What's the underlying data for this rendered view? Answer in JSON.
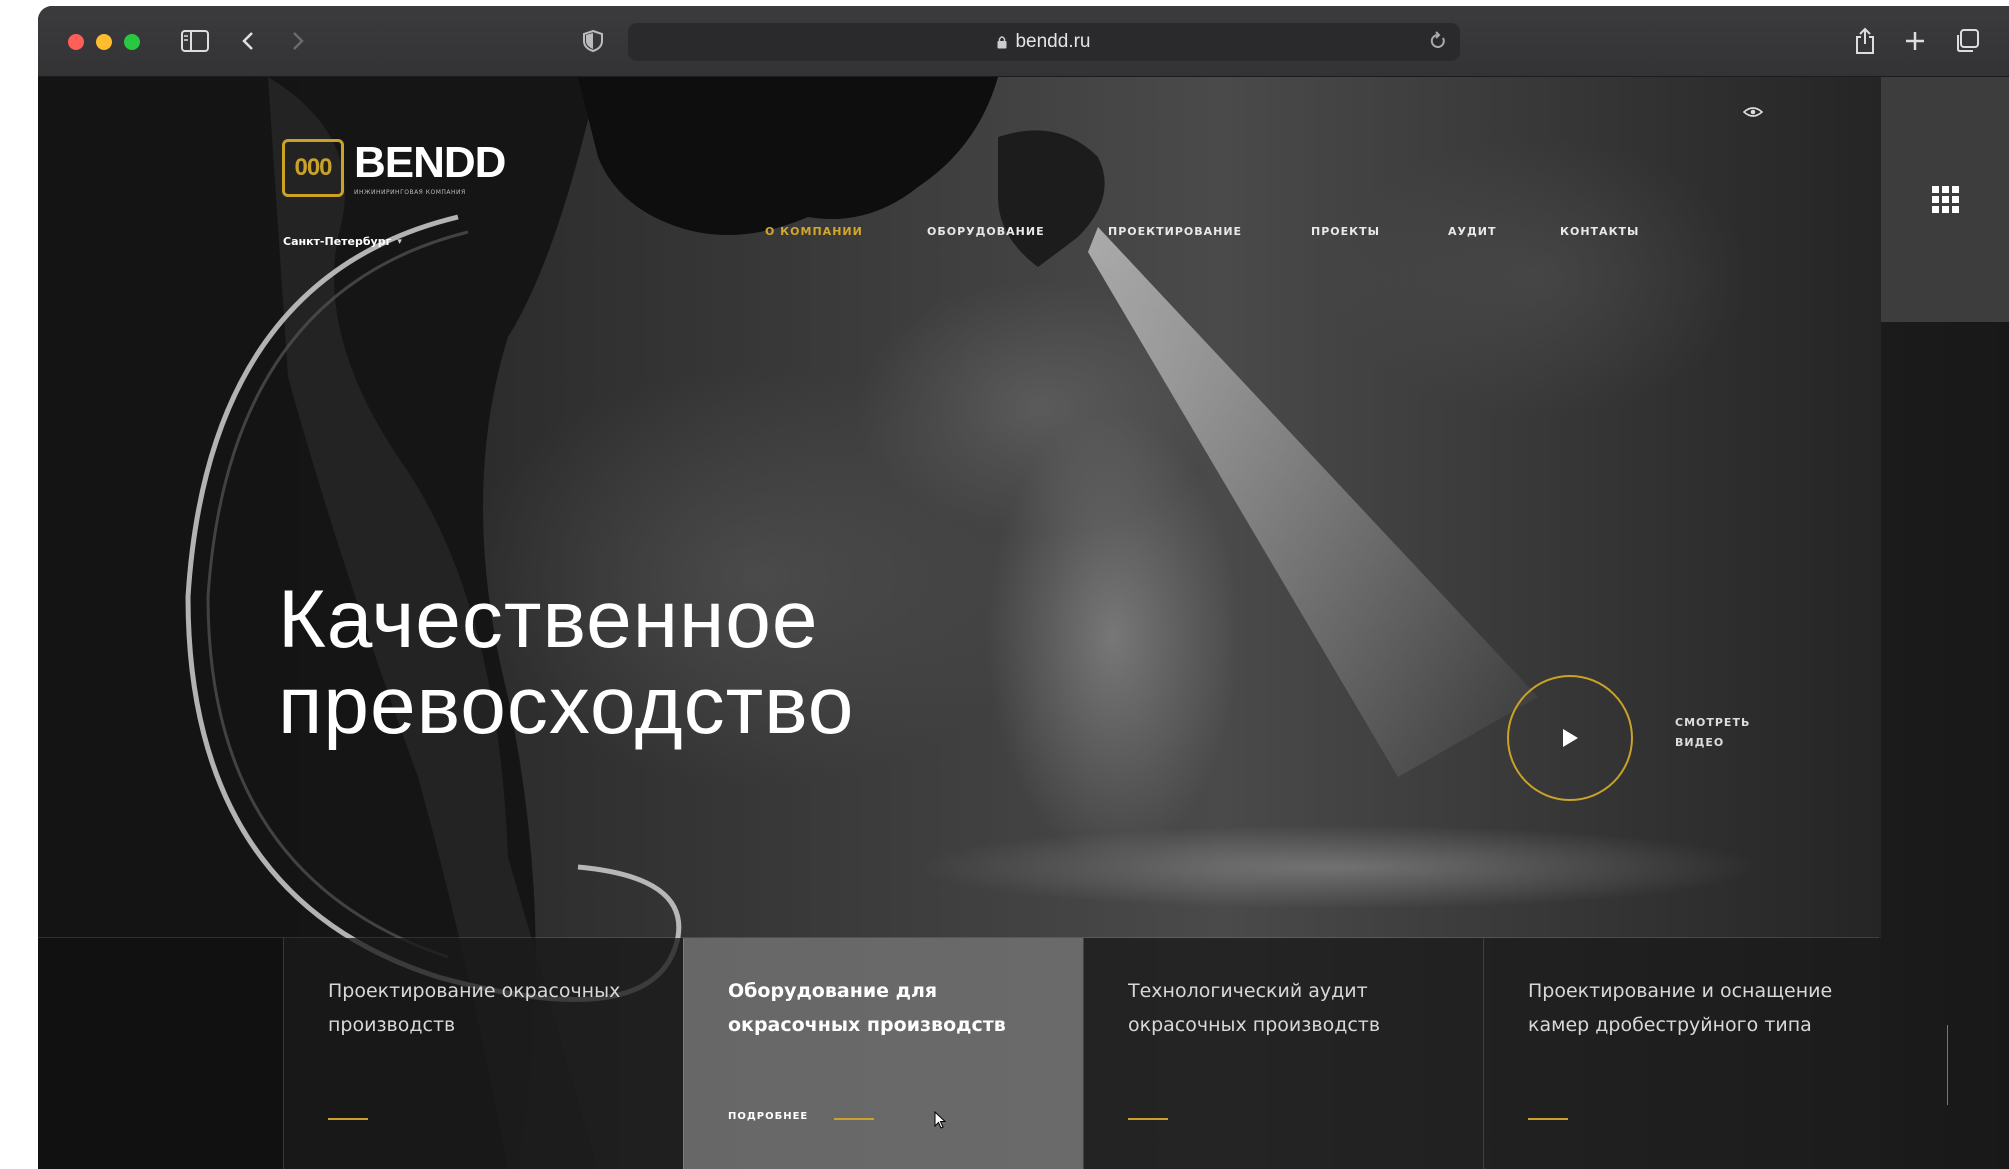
{
  "browser": {
    "url": "bendd.ru"
  },
  "header": {
    "logo_mark": "000",
    "logo_name": "BENDD",
    "logo_tagline": "ИНЖИНИРИНГОВАЯ КОМПАНИЯ",
    "city": "Санкт-Петербург"
  },
  "nav": [
    {
      "label": "О компании",
      "active": true
    },
    {
      "label": "Оборудование",
      "active": false
    },
    {
      "label": "Проектирование",
      "active": false
    },
    {
      "label": "Проекты",
      "active": false
    },
    {
      "label": "Аудит",
      "active": false
    },
    {
      "label": "Контакты",
      "active": false
    }
  ],
  "hero": {
    "headline_line1": "Качественное",
    "headline_line2": "превосходство",
    "video_label_line1": "СМОТРЕТЬ",
    "video_label_line2": "ВИДЕО"
  },
  "cards": [
    {
      "title": "Проектирование окрасочных производств",
      "active": false
    },
    {
      "title": "Оборудование для окрасочных производств",
      "active": true,
      "more": "ПОДРОБНЕЕ"
    },
    {
      "title": "Технологический аудит окрасочных производств",
      "active": false
    },
    {
      "title": "Проектирование и оснащение камер дробеструйного типа",
      "active": false
    }
  ],
  "colors": {
    "accent": "#c9a227",
    "page_bg": "#111111"
  },
  "icons": [
    "sidebar-icon",
    "back-icon",
    "forward-icon",
    "shield-icon",
    "lock-icon",
    "reload-icon",
    "share-icon",
    "new-tab-icon",
    "tabs-icon",
    "eye-icon",
    "grid-menu-icon",
    "play-icon",
    "arrow-icon",
    "cursor-icon"
  ]
}
